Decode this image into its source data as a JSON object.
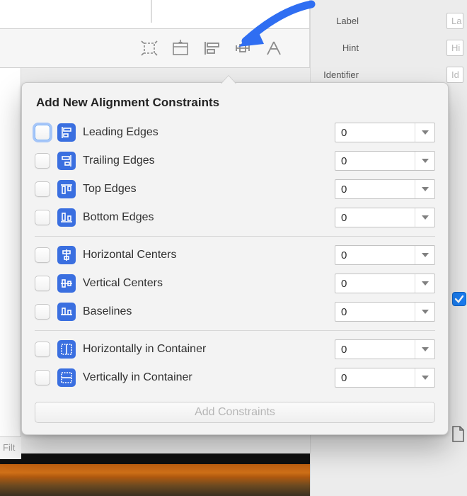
{
  "inspector": {
    "label_label": "Label",
    "label_placeholder": "La",
    "hint_label": "Hint",
    "hint_placeholder": "Hi",
    "identifier_label": "Identifier",
    "identifier_placeholder": "Id"
  },
  "filter_placeholder": "Filt",
  "popover": {
    "title": "Add New Alignment Constraints",
    "groups": [
      [
        {
          "icon": "leading",
          "label": "Leading Edges",
          "value": "0",
          "focused": true
        },
        {
          "icon": "trailing",
          "label": "Trailing Edges",
          "value": "0"
        },
        {
          "icon": "top",
          "label": "Top Edges",
          "value": "0"
        },
        {
          "icon": "bottom",
          "label": "Bottom Edges",
          "value": "0"
        }
      ],
      [
        {
          "icon": "hcenter",
          "label": "Horizontal Centers",
          "value": "0"
        },
        {
          "icon": "vcenter",
          "label": "Vertical Centers",
          "value": "0"
        },
        {
          "icon": "baseline",
          "label": "Baselines",
          "value": "0"
        }
      ],
      [
        {
          "icon": "hcontainer",
          "label": "Horizontally in Container",
          "value": "0"
        },
        {
          "icon": "vcontainer",
          "label": "Vertically in Container",
          "value": "0"
        }
      ]
    ],
    "add_button": "Add Constraints"
  }
}
